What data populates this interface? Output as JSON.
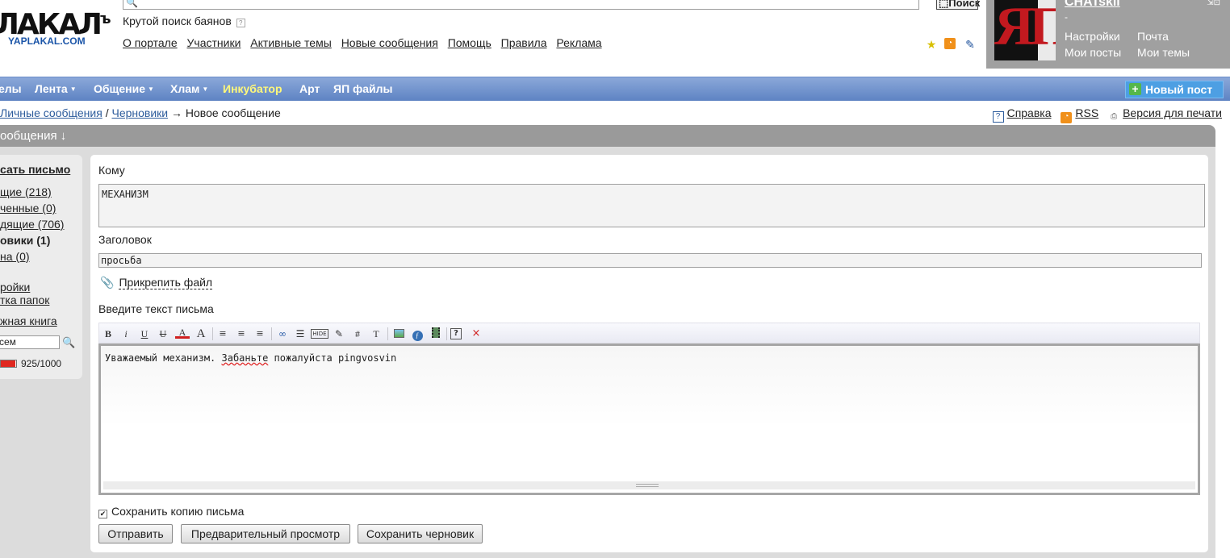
{
  "header": {
    "logo_text": "ЯПЛАКАЛЪ",
    "logo_subtext": "YAPLAKAL.COM",
    "search_button": "Поиск",
    "tagline": "Крутой поиск баянов",
    "tagline_help": "?",
    "nav": [
      "О портале",
      "Участники",
      "Активные темы",
      "Новые сообщения",
      "Помощь",
      "Правила",
      "Реклама"
    ]
  },
  "user": {
    "name": "CHATskii",
    "status": "-",
    "links": {
      "settings": "Настройки",
      "mail": "Почта",
      "my_posts": "Мои посты",
      "my_topics": "Мои темы"
    }
  },
  "navbar": {
    "items": [
      "елы",
      "Лента",
      "Общение",
      "Хлам",
      "Инкубатор",
      "Арт",
      "ЯП файлы"
    ],
    "new_post": "Новый пост"
  },
  "breadcrumb": {
    "crumb1": "Личные сообщения",
    "sep": "/",
    "crumb2": "Черновики",
    "arrow": "→",
    "current": "Новое сообщение"
  },
  "right_links": {
    "help": "Справка",
    "rss": "RSS",
    "print": "Версия для печати"
  },
  "section": {
    "title": "ообщения ↓"
  },
  "sidebar": {
    "write": "сать письмо",
    "incoming": "щие (218)",
    "unread": "ченные (0)",
    "outgoing": "дящие (706)",
    "drafts": "овики (1)",
    "trash": "на (0)",
    "settings": "ройки",
    "folders": "тка папок",
    "address_book": "жная книга",
    "search_value": "сем",
    "quota_text": "925/1000",
    "quota_fraction": 0.925
  },
  "form": {
    "to_label": "Кому",
    "to_value": "МЕХАНИЗМ",
    "subject_label": "Заголовок",
    "subject_value": "просьба",
    "attach": "Прикрепить файл",
    "body_label": "Введите текст письма",
    "body_pre": "Уважаемый механизм. ",
    "body_misspelled": "Забаньте",
    "body_post": " пожалуйста pingvosvin",
    "save_copy": "Сохранить копию письма",
    "send": "Отправить",
    "preview": "Предварительный просмотр",
    "save_draft": "Сохранить черновик"
  },
  "toolbar": {
    "bold": "B",
    "italic": "i",
    "underline": "U",
    "strike": "U",
    "color": "A",
    "size": "A",
    "hide": "HIDE",
    "hash": "#",
    "text": "T",
    "help": "?",
    "remove": "×"
  }
}
